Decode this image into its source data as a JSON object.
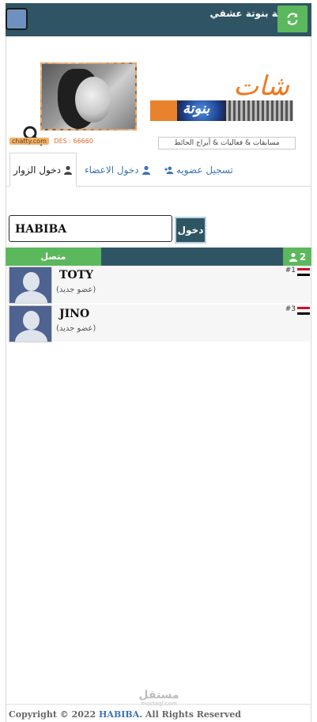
{
  "header": {
    "site_title": "دردشة بنوتة عشقي",
    "refresh_icon": "refresh-icon",
    "colors": {
      "bar": "#2f5564",
      "accent": "#5cb85c"
    }
  },
  "banner": {
    "chat_word": "شات",
    "logo_word": "بنوتة",
    "caption": "مسابقات & فعاليات & أبراج الحائط",
    "stamp_site": "chatty.com",
    "stamp_code": "DES : 66660"
  },
  "tabs": {
    "visitors": "دخول الزوار",
    "members": "دخول الاعضاء",
    "register": "تسجيل عضويه"
  },
  "login": {
    "username_value": "HABIBA",
    "submit_label": "دخول"
  },
  "online": {
    "label": "متصل",
    "count": "2"
  },
  "users": [
    {
      "name": "TOTY",
      "status": "(عضو جديد)",
      "rank": "#1",
      "flag": "egypt-flag"
    },
    {
      "name": "JINO",
      "status": "(عضو جديد)",
      "rank": "#3",
      "flag": "egypt-flag"
    }
  ],
  "watermark": {
    "arabic": "مستقل",
    "latin": "mostaql.com"
  },
  "footer": {
    "prefix": "Copyright © 2022 ",
    "brand": "HABIBA",
    "suffix": ". All Rights Reserved"
  }
}
